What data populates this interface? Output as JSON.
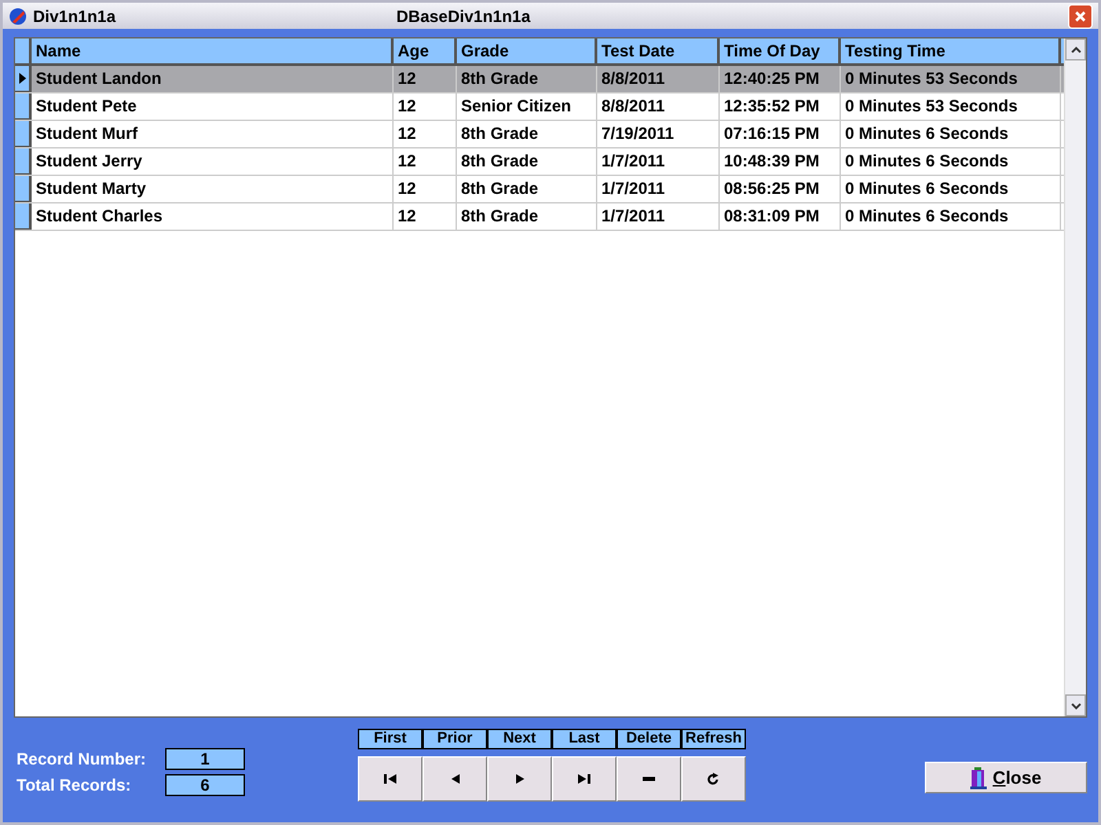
{
  "window": {
    "title": "Div1n1n1a",
    "caption": "DBaseDiv1n1n1a"
  },
  "table": {
    "columns": [
      "Name",
      "Age",
      "Grade",
      "Test Date",
      "Time Of Day",
      "Testing Time"
    ],
    "rows": [
      {
        "cells": [
          "Student Landon",
          "12",
          "8th Grade",
          "8/8/2011",
          "12:40:25 PM",
          "0 Minutes  53 Seconds"
        ],
        "selected": true
      },
      {
        "cells": [
          "Student Pete",
          "12",
          "Senior Citizen",
          "8/8/2011",
          "12:35:52 PM",
          "0 Minutes  53 Seconds"
        ],
        "selected": false
      },
      {
        "cells": [
          "Student Murf",
          "12",
          "8th Grade",
          "7/19/2011",
          "07:16:15 PM",
          "0 Minutes  6 Seconds"
        ],
        "selected": false
      },
      {
        "cells": [
          "Student Jerry",
          "12",
          "8th Grade",
          "1/7/2011",
          "10:48:39 PM",
          "0 Minutes  6 Seconds"
        ],
        "selected": false
      },
      {
        "cells": [
          "Student Marty",
          "12",
          "8th Grade",
          "1/7/2011",
          "08:56:25 PM",
          "0 Minutes  6 Seconds"
        ],
        "selected": false
      },
      {
        "cells": [
          "Student Charles",
          "12",
          "8th Grade",
          "1/7/2011",
          "08:31:09 PM",
          "0 Minutes  6 Seconds"
        ],
        "selected": false
      }
    ]
  },
  "record_number": {
    "label": "Record Number:",
    "value": "1"
  },
  "total_records": {
    "label": "Total Records:",
    "value": "6"
  },
  "navigator": [
    {
      "label": "First",
      "kind": "first"
    },
    {
      "label": "Prior",
      "kind": "prior"
    },
    {
      "label": "Next",
      "kind": "next"
    },
    {
      "label": "Last",
      "kind": "last"
    },
    {
      "label": "Delete",
      "kind": "delete"
    },
    {
      "label": "Refresh",
      "kind": "refresh"
    }
  ],
  "close_button": {
    "label": "Close"
  }
}
